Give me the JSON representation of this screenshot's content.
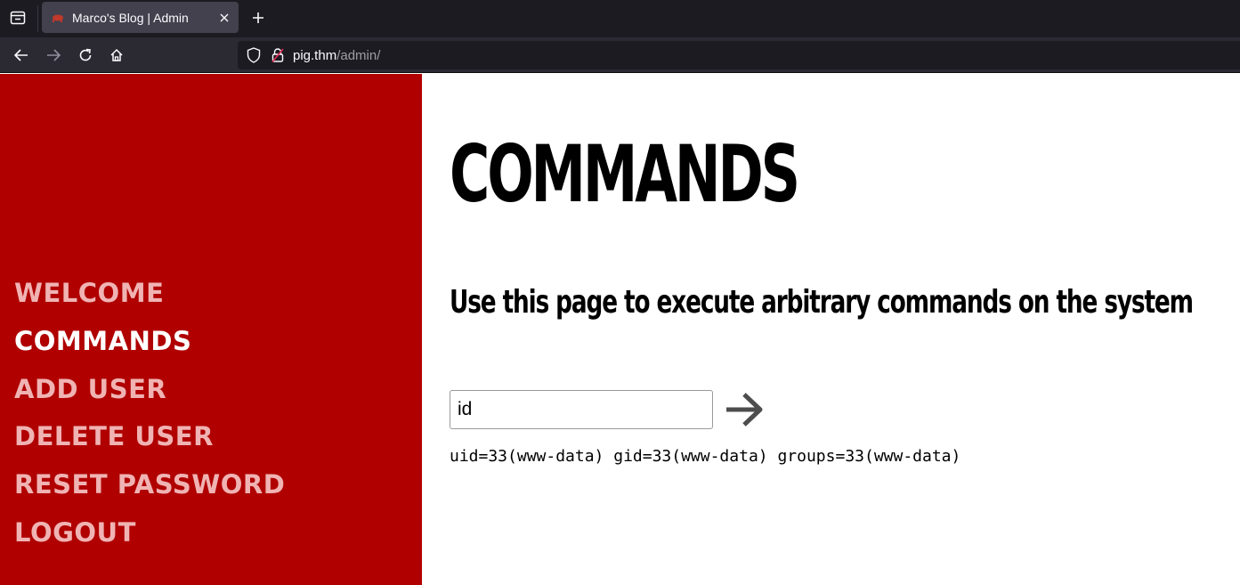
{
  "browser": {
    "tab": {
      "title": "Marco's Blog | Admin"
    },
    "url": {
      "host": "pig.thm",
      "path": "/admin/"
    }
  },
  "sidebar": {
    "items": [
      {
        "label": "WELCOME",
        "active": false
      },
      {
        "label": "COMMANDS",
        "active": true
      },
      {
        "label": "ADD USER",
        "active": false
      },
      {
        "label": "DELETE USER",
        "active": false
      },
      {
        "label": "RESET PASSWORD",
        "active": false
      },
      {
        "label": "LOGOUT",
        "active": false
      }
    ]
  },
  "main": {
    "title": "COMMANDS",
    "subtitle": "Use this page to execute arbitrary commands on the system",
    "command_input": {
      "value": "id"
    },
    "output": "uid=33(www-data) gid=33(www-data) groups=33(www-data)"
  },
  "colors": {
    "sidebar_bg": "#b00000",
    "menu_inactive": "#f0b3b3",
    "menu_active": "#ffffff",
    "browser_chrome": "#1c1b22"
  }
}
